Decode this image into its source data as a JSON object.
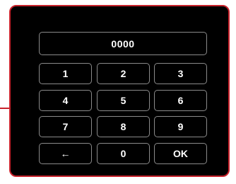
{
  "colors": {
    "panel_border": "#c8232c",
    "panel_background": "#000000",
    "key_border": "#8a8a8a",
    "text": "#ffffff"
  },
  "display": {
    "value": "0000"
  },
  "keys": {
    "k1": "1",
    "k2": "2",
    "k3": "3",
    "k4": "4",
    "k5": "5",
    "k6": "6",
    "k7": "7",
    "k8": "8",
    "k9": "9",
    "backspace": "←",
    "k0": "0",
    "ok": "OK"
  }
}
